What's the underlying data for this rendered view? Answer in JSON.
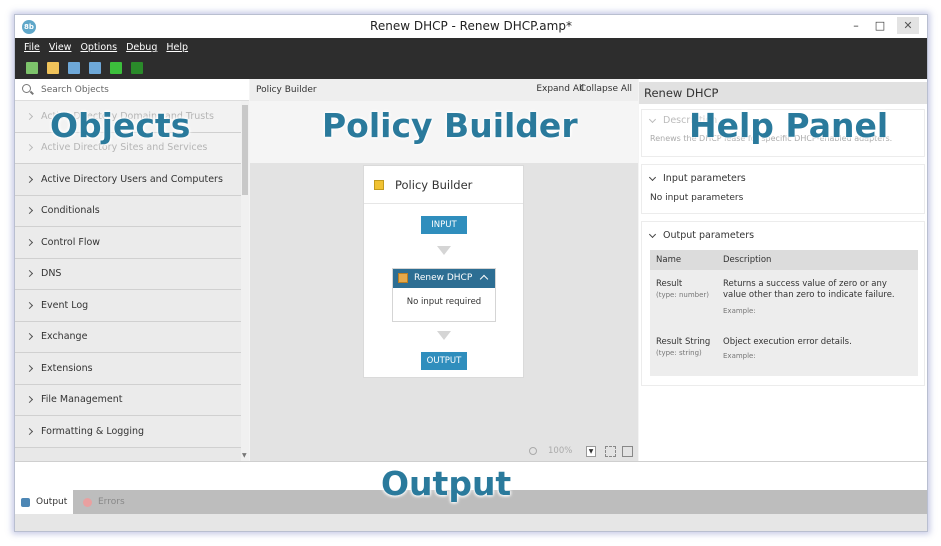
{
  "window": {
    "title": "Renew DHCP - Renew DHCP.amp*",
    "app_icon_text": "8b",
    "controls": {
      "minimize": "–",
      "maximize": "□",
      "close": "✕"
    }
  },
  "menu": [
    "File",
    "View",
    "Options",
    "Debug",
    "Help"
  ],
  "toolbar": {
    "buttons": [
      {
        "icon": "new-icon",
        "color": "#7dc36b"
      },
      {
        "icon": "open-folder-icon",
        "color": "#f0c35a"
      },
      {
        "icon": "save-icon",
        "color": "#6ea8d8"
      },
      {
        "icon": "save-as-icon",
        "color": "#6ea8d8"
      },
      {
        "icon": "run-icon",
        "color": "#3cbf3c"
      },
      {
        "icon": "stop-icon",
        "color": "#2a8a2a"
      }
    ]
  },
  "objects": {
    "search_placeholder": "Search Objects",
    "items": [
      {
        "label": "Active Directory Domains and Trusts",
        "faded": true
      },
      {
        "label": "Active Directory Sites and Services",
        "faded": true
      },
      {
        "label": "Active Directory Users and Computers",
        "faded": false
      },
      {
        "label": "Conditionals",
        "faded": false
      },
      {
        "label": "Control Flow",
        "faded": false
      },
      {
        "label": "DNS",
        "faded": false
      },
      {
        "label": "Event Log",
        "faded": false
      },
      {
        "label": "Exchange",
        "faded": false
      },
      {
        "label": "Extensions",
        "faded": false
      },
      {
        "label": "File Management",
        "faded": false
      },
      {
        "label": "Formatting & Logging",
        "faded": false
      }
    ]
  },
  "builder": {
    "title": "Policy Builder",
    "expand_all": "Expand All",
    "collapse_all": "Collapse All",
    "card_title": "Policy Builder",
    "input_label": "INPUT",
    "output_label": "OUTPUT",
    "step": {
      "label": "Renew DHCP",
      "body": "No input required"
    },
    "zoom": "100%"
  },
  "help": {
    "title": "Renew DHCP",
    "description_header": "Description",
    "description_text": "Renews the DHCP lease for specific DHCP-enabled adapters.",
    "input_header": "Input parameters",
    "input_text": "No input parameters",
    "output_header": "Output parameters",
    "table_headers": {
      "name": "Name",
      "description": "Description"
    },
    "rows": [
      {
        "name": "Result",
        "type": "(type: number)",
        "description": "Returns a success value of zero or any value other than zero to indicate failure.",
        "example": "Example:"
      },
      {
        "name": "Result String",
        "type": "(type: string)",
        "description": "Object execution error details.",
        "example": "Example:"
      }
    ]
  },
  "bottom": {
    "tabs": [
      "Output",
      "Errors"
    ]
  },
  "overlays": {
    "objects": "Objects",
    "policy_builder": "Policy Builder",
    "help_panel": "Help Panel",
    "output": "Output"
  }
}
